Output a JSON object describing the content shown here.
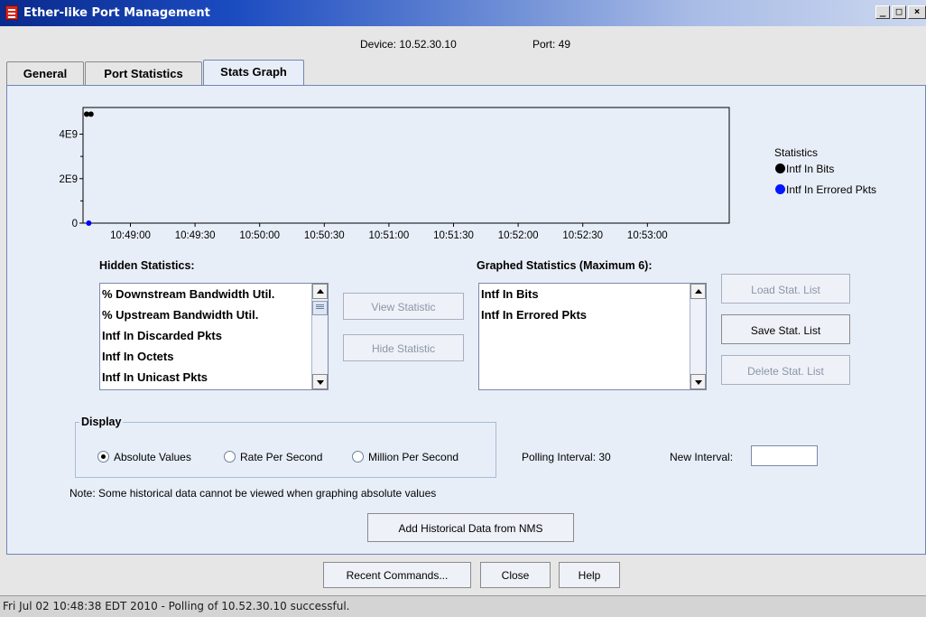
{
  "window": {
    "title": "Ether-like Port Management",
    "buttons": {
      "minimize": "_",
      "maximize": "□",
      "close": "×"
    }
  },
  "header": {
    "device": "Device: 10.52.30.10",
    "port": "Port: 49"
  },
  "tabs": [
    {
      "label": "General",
      "active": false
    },
    {
      "label": "Port Statistics",
      "active": false
    },
    {
      "label": "Stats Graph",
      "active": true
    }
  ],
  "chart_data": {
    "type": "scatter",
    "title": "",
    "xlabel": "",
    "ylabel": "",
    "y_tick_labels": [
      "0",
      "2E9",
      "4E9"
    ],
    "y_ticks": [
      0,
      2000000000,
      4000000000
    ],
    "ylim": [
      0,
      5200000000
    ],
    "x_tick_labels": [
      "10:49:00",
      "10:49:30",
      "10:50:00",
      "10:50:30",
      "10:51:00",
      "10:51:30",
      "10:52:00",
      "10:52:30",
      "10:53:00"
    ],
    "x_ticks_seconds": [
      22,
      52,
      82,
      112,
      142,
      172,
      202,
      232,
      262
    ],
    "xlim_seconds": [
      0,
      300
    ],
    "grid": false,
    "legend_title": "Statistics",
    "legend_position": "right",
    "series": [
      {
        "name": "Intf In Bits",
        "color": "#000000",
        "points": [
          [
            0,
            4900000000
          ],
          [
            2,
            4900000000
          ]
        ]
      },
      {
        "name": "Intf In Errored Pkts",
        "color": "#0000ff",
        "points": [
          [
            1,
            0
          ]
        ]
      }
    ]
  },
  "hidden_statistics": {
    "label": "Hidden Statistics:",
    "items": [
      "% Downstream Bandwidth Util.",
      "% Upstream Bandwidth Util.",
      "Intf In Discarded Pkts",
      "Intf In Octets",
      "Intf In Unicast Pkts"
    ]
  },
  "graphed_statistics": {
    "label": "Graphed Statistics (Maximum 6):",
    "items": [
      "Intf In Bits",
      "Intf In Errored Pkts"
    ]
  },
  "middle_buttons": {
    "view": "View Statistic",
    "hide": "Hide Statistic"
  },
  "right_buttons": {
    "load": "Load Stat. List",
    "save": "Save Stat. List",
    "delete": "Delete Stat. List"
  },
  "display": {
    "title": "Display",
    "options": [
      {
        "label": "Absolute Values",
        "selected": true
      },
      {
        "label": "Rate Per Second",
        "selected": false
      },
      {
        "label": "Million Per Second",
        "selected": false
      }
    ],
    "polling_interval": "Polling Interval: 30",
    "new_interval_label": "New Interval:",
    "new_interval_value": ""
  },
  "note": "Note: Some historical data cannot be viewed when graphing absolute values",
  "add_historical_button": "Add Historical Data from NMS",
  "bottom_buttons": {
    "recent": "Recent Commands...",
    "close": "Close",
    "help": "Help"
  },
  "status": "Fri Jul 02 10:48:38 EDT 2010 - Polling of 10.52.30.10 successful."
}
